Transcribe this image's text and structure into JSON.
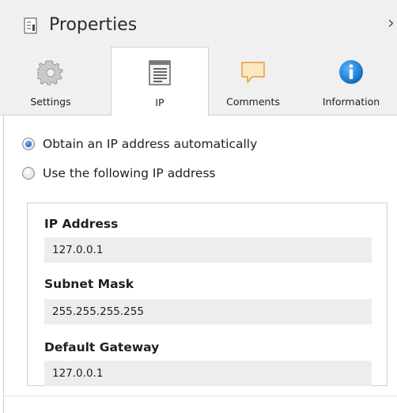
{
  "header": {
    "title": "Properties",
    "close_glyph": "›",
    "icon": "properties-document-icon"
  },
  "tabs": [
    {
      "label": "Settings",
      "icon": "gear-icon",
      "active": false
    },
    {
      "label": "IP",
      "icon": "ip-list-icon",
      "active": true
    },
    {
      "label": "Comments",
      "icon": "speech-bubble-icon",
      "active": false
    },
    {
      "label": "Information",
      "icon": "info-icon",
      "active": false
    }
  ],
  "ip_mode": {
    "options": [
      {
        "label": "Obtain an IP address automatically",
        "checked": true
      },
      {
        "label": "Use the following IP address",
        "checked": false
      }
    ]
  },
  "fields": [
    {
      "label": "IP Address",
      "value": "127.0.0.1"
    },
    {
      "label": "Subnet Mask",
      "value": "255.255.255.255"
    },
    {
      "label": "Default Gateway",
      "value": "127.0.0.1"
    }
  ],
  "colors": {
    "header_bg": "#f0f0f0",
    "radio_selected": "#2c6fd6",
    "field_bg": "#ededed",
    "info_icon": "#1e7fd6",
    "comment_icon_fill": "#fde7c2",
    "comment_icon_stroke": "#e29a3a"
  }
}
